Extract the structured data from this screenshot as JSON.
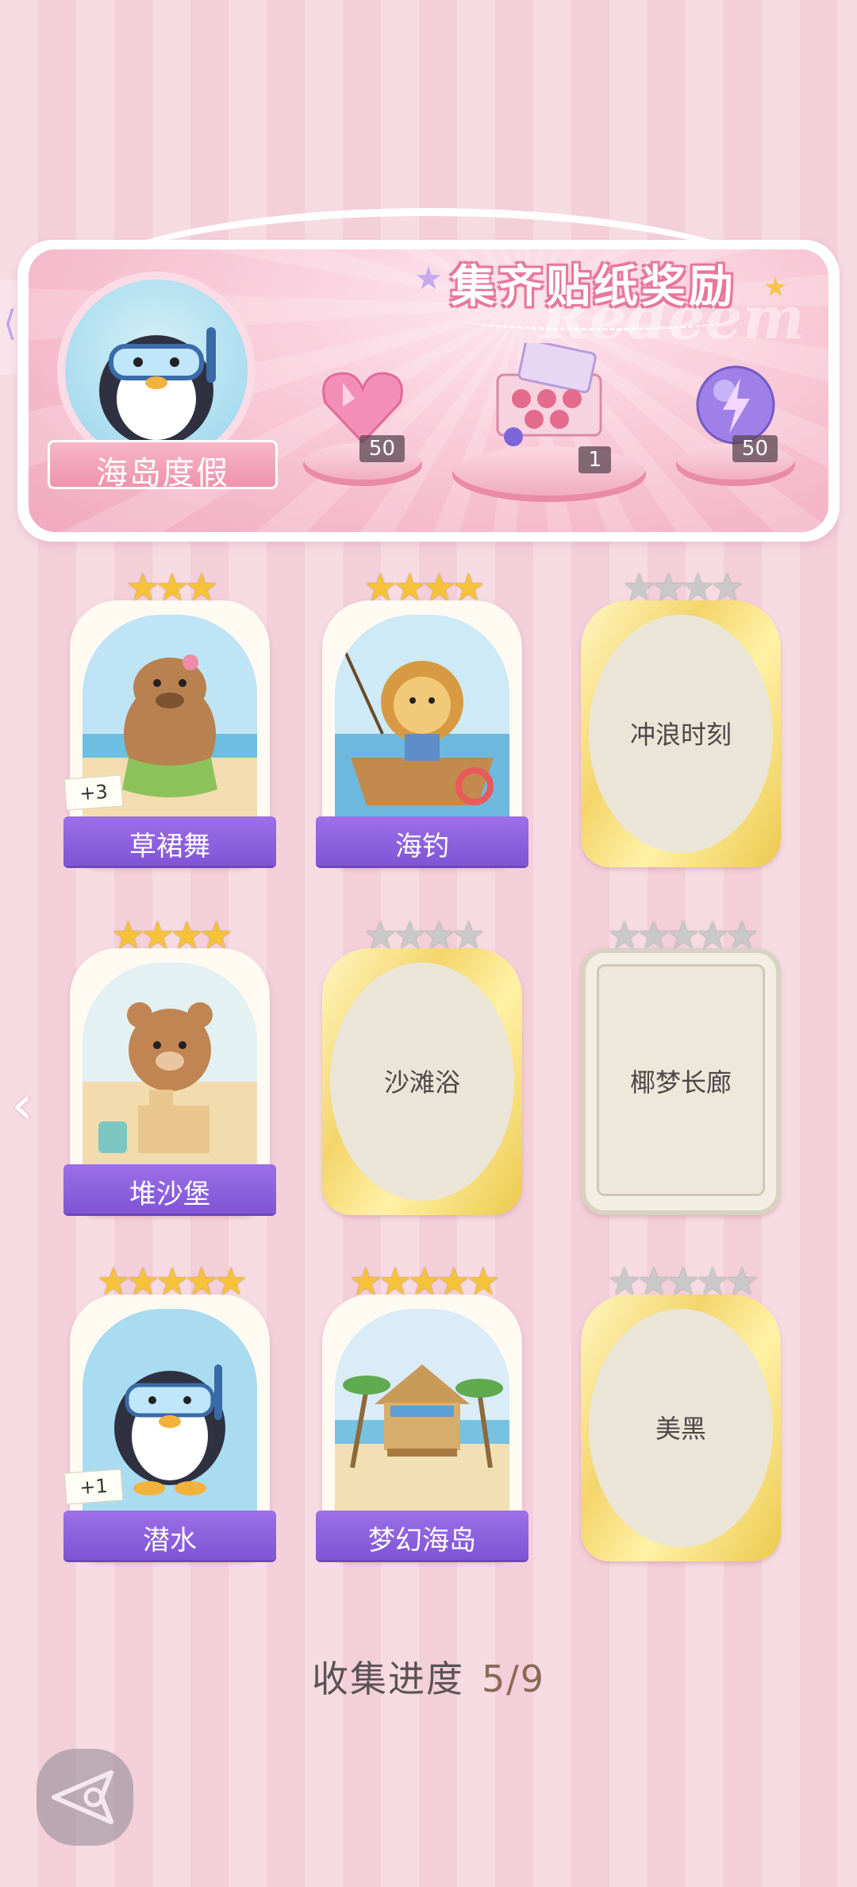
{
  "banner": {
    "title": "集齐贴纸奖励",
    "watermark": "Redeem",
    "theme_name": "海岛度假",
    "rewards": [
      {
        "icon": "pink-heart-gem-icon",
        "qty": "50"
      },
      {
        "icon": "sticker-pack-box-icon",
        "qty": "1"
      },
      {
        "icon": "purple-lightning-orb-icon",
        "qty": "50"
      }
    ]
  },
  "cards": [
    {
      "name": "草裙舞",
      "stars": 3,
      "max_stars": 3,
      "unlocked": true,
      "dup": "+3",
      "art": "capybara-hula-icon"
    },
    {
      "name": "海钓",
      "stars": 4,
      "max_stars": 4,
      "unlocked": true,
      "dup": "",
      "art": "lion-fishing-boat-icon"
    },
    {
      "name": "冲浪时刻",
      "stars": 0,
      "max_stars": 4,
      "unlocked": false
    },
    {
      "name": "堆沙堡",
      "stars": 4,
      "max_stars": 4,
      "unlocked": true,
      "dup": "",
      "art": "bear-sandcastle-icon"
    },
    {
      "name": "沙滩浴",
      "stars": 0,
      "max_stars": 4,
      "unlocked": false
    },
    {
      "name": "椰梦长廊",
      "stars": 0,
      "max_stars": 5,
      "unlocked": false
    },
    {
      "name": "潜水",
      "stars": 5,
      "max_stars": 5,
      "unlocked": true,
      "dup": "+1",
      "art": "penguin-snorkel-icon"
    },
    {
      "name": "梦幻海岛",
      "stars": 5,
      "max_stars": 5,
      "unlocked": true,
      "dup": "",
      "art": "beach-hut-island-icon"
    },
    {
      "name": "美黑",
      "stars": 0,
      "max_stars": 5,
      "unlocked": false
    }
  ],
  "progress": {
    "label": "收集进度",
    "value": "5/9"
  },
  "nav": {
    "prev_arrow": "‹",
    "back": "back-icon"
  },
  "colors": {
    "accent_purple": "#8b5fdd",
    "star_gold": "#f5c23a",
    "pink": "#ee93ae"
  }
}
